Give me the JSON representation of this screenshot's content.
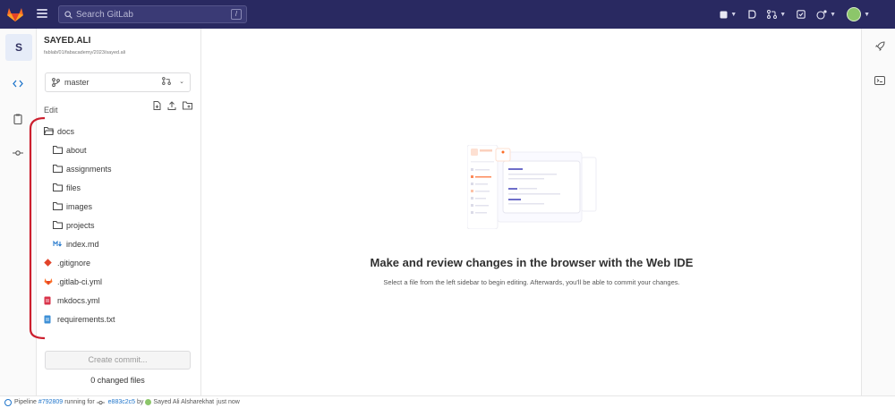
{
  "colors": {
    "navbar": "#292961",
    "accent_blue": "#1f75cb",
    "annotation_red": "#cc1f2e",
    "gitlab_orange": "#fc6d26"
  },
  "navbar": {
    "search_placeholder": "Search GitLab",
    "search_shortcut": "/"
  },
  "project": {
    "avatar_letter": "S",
    "name": "SAYED.ALI",
    "path": "fablab/01/fabacademy/2023/sayed.ali"
  },
  "branch": {
    "name": "master"
  },
  "edit_label": "Edit",
  "tree": [
    {
      "label": "docs",
      "type": "folder-open",
      "level": 0
    },
    {
      "label": "about",
      "type": "folder",
      "level": 1
    },
    {
      "label": "assignments",
      "type": "folder",
      "level": 1
    },
    {
      "label": "files",
      "type": "folder",
      "level": 1
    },
    {
      "label": "images",
      "type": "folder",
      "level": 1
    },
    {
      "label": "projects",
      "type": "folder",
      "level": 1
    },
    {
      "label": "index.md",
      "type": "markdown",
      "level": 1
    },
    {
      "label": ".gitignore",
      "type": "git",
      "level": 0
    },
    {
      "label": ".gitlab-ci.yml",
      "type": "gitlab",
      "level": 0
    },
    {
      "label": "mkdocs.yml",
      "type": "yaml",
      "level": 0
    },
    {
      "label": "requirements.txt",
      "type": "text",
      "level": 0
    }
  ],
  "commit": {
    "button_label": "Create commit...",
    "changed_files": "0 changed files"
  },
  "empty_state": {
    "title": "Make and review changes in the browser with the Web IDE",
    "description": "Select a file from the left sidebar to begin editing. Afterwards, you'll be able to commit your changes."
  },
  "status": {
    "pipeline_prefix": "Pipeline",
    "pipeline_id": "#792809",
    "running_for": "running for",
    "commit_sha": "e883c2c5",
    "by": "by",
    "user": "Sayed Ali Alsharekhat",
    "time": "just now"
  }
}
